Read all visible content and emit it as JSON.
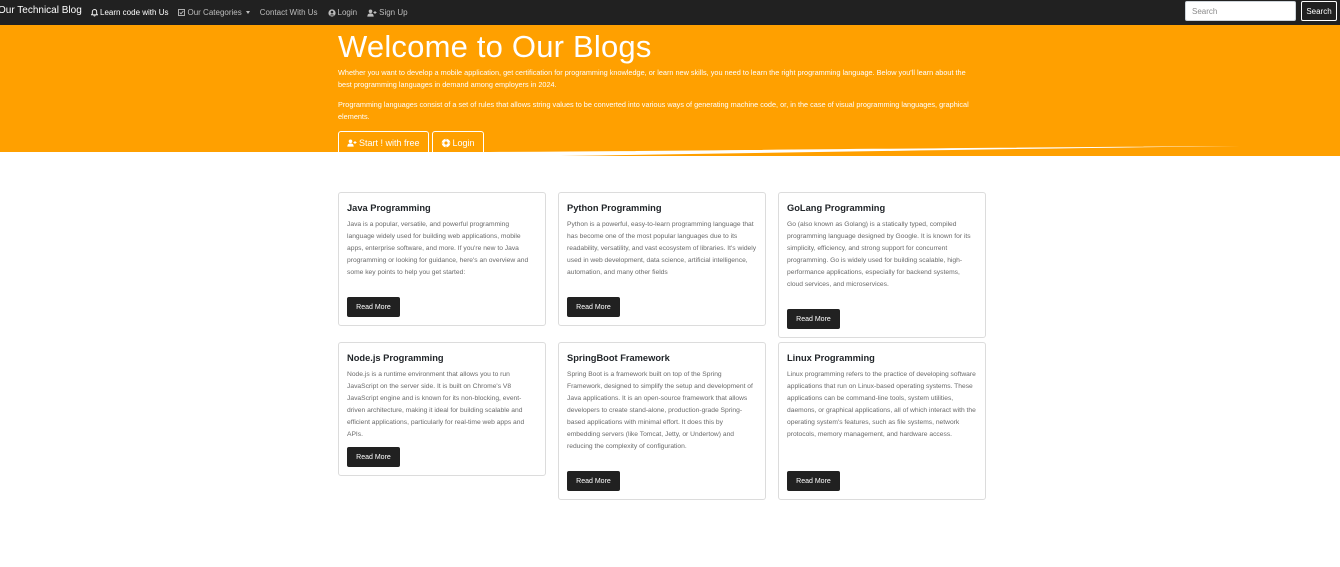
{
  "navbar": {
    "brand": "Our Technical Blog",
    "links": [
      {
        "label": "Learn code with Us",
        "icon": "bell-icon"
      },
      {
        "label": "Our Categories",
        "icon": "checklist-icon"
      },
      {
        "label": "Contact With Us"
      },
      {
        "label": "Login",
        "icon": "user-circle-icon"
      },
      {
        "label": "Sign Up",
        "icon": "user-plus-icon"
      }
    ],
    "search_placeholder": "Search",
    "search_button": "Search"
  },
  "hero": {
    "title": "Welcome to Our Blogs",
    "paragraph1": "Whether you want to develop a mobile application, get certification for programming knowledge, or learn new skills, you need to learn the right programming language. Below you'll learn about the best programming languages in demand among employers in 2024.",
    "paragraph2": "Programming languages consist of a set of rules that allows string values to be converted into various ways of generating machine code, or, in the case of visual programming languages, graphical elements.",
    "start_button": "Start ! with free",
    "login_button": "Login"
  },
  "cards": [
    {
      "title": "Java Programming",
      "text": "Java is a popular, versatile, and powerful programming language widely used for building web applications, mobile apps, enterprise software, and more. If you're new to Java programming or looking for guidance, here's an overview and some key points to help you get started:",
      "button": "Read More"
    },
    {
      "title": "Python Programming",
      "text": "Python is a powerful, easy-to-learn programming language that has become one of the most popular languages due to its readability, versatility, and vast ecosystem of libraries. It's widely used in web development, data science, artificial intelligence, automation, and many other fields",
      "button": "Read More"
    },
    {
      "title": "GoLang Programming",
      "text": "Go (also known as Golang) is a statically typed, compiled programming language designed by Google. It is known for its simplicity, efficiency, and strong support for concurrent programming. Go is widely used for building scalable, high-performance applications, especially for backend systems, cloud services, and microservices.",
      "button": "Read More"
    },
    {
      "title": "Node.js Programming",
      "text": "Node.js is a runtime environment that allows you to run JavaScript on the server side. It is built on Chrome's V8 JavaScript engine and is known for its non-blocking, event-driven architecture, making it ideal for building scalable and efficient applications, particularly for real-time web apps and APIs.",
      "button": "Read More"
    },
    {
      "title": "SpringBoot Framework",
      "text": "Spring Boot is a framework built on top of the Spring Framework, designed to simplify the setup and development of Java applications. It is an open-source framework that allows developers to create stand-alone, production-grade Spring-based applications with minimal effort. It does this by embedding servers (like Tomcat, Jetty, or Undertow) and reducing the complexity of configuration.",
      "button": "Read More"
    },
    {
      "title": "Linux Programming",
      "text": "Linux programming refers to the practice of developing software applications that run on Linux-based operating systems. These applications can be command-line tools, system utilities, daemons, or graphical applications, all of which interact with the operating system's features, such as file systems, network protocols, memory management, and hardware access.",
      "button": "Read More"
    }
  ],
  "colors": {
    "navbar_bg": "#212121",
    "hero_bg": "#ffa000",
    "button_dark": "#212121",
    "card_border": "#dcdcdc"
  }
}
